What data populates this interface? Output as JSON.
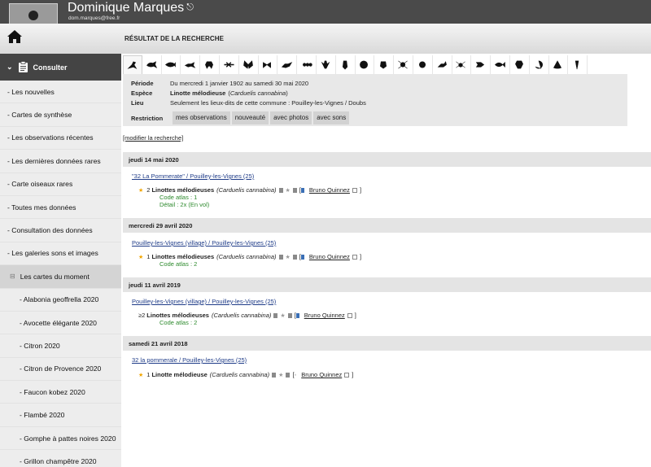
{
  "user": {
    "name": "Dominique Marques",
    "email": "dom.marques@free.fr"
  },
  "page": {
    "title": "RÉSULTAT DE LA RECHERCHE"
  },
  "sidebar": {
    "section": "Consulter",
    "items": [
      "- Les nouvelles",
      "- Cartes de synthèse",
      "- Les observations récentes",
      "- Les dernières données rares",
      "- Carte oiseaux rares",
      "- Toutes mes données",
      "- Consultation des données",
      "- Les galeries sons et images"
    ],
    "group": "Les cartes du moment",
    "subitems": [
      "- Alabonia geoffrella 2020",
      "- Avocette élégante 2020",
      "- Citron 2020",
      "- Citron de Provence 2020",
      "- Faucon kobez 2020",
      "- Flambé 2020",
      "- Gomphe à pattes noires 2020",
      "- Grillon champêtre 2020"
    ]
  },
  "criteria": {
    "period_label": "Période",
    "period_value": "Du mercredi 1 janvier 1902 au samedi 30 mai 2020",
    "species_label": "Espèce",
    "species_name": "Linotte mélodieuse",
    "species_latin": "Carduelis cannabina",
    "place_label": "Lieu",
    "place_value": "Seulement les lieux-dits de cette commune : Pouilley-les-Vignes / Doubs",
    "restriction_label": "Restriction",
    "tabs": [
      "mes observations",
      "nouveauté",
      "avec photos",
      "avec sons"
    ]
  },
  "modify_link": "[modifier la recherche]",
  "observations": [
    {
      "date": "jeudi 14 mai 2020",
      "location": "\"32 La Pommerate\" / Pouilley-les-Vignes (25)",
      "count": "2",
      "species": "Linottes mélodieuses",
      "latin": "(Carduelis cannabina)",
      "observer": "Bruno Quinnez",
      "code": "Code atlas : 1",
      "detail": "Détail : 2x (En vol)"
    },
    {
      "date": "mercredi 29 avril 2020",
      "location": "Pouilley-les-Vignes (village) / Pouilley-les-Vignes (25)",
      "count": "1",
      "species": "Linottes mélodieuses",
      "latin": "(Carduelis cannabina)",
      "observer": "Bruno Quinnez",
      "code": "Code atlas : 2"
    },
    {
      "date": "jeudi 11 avril 2019",
      "location": "Pouilley-les-Vignes (village) / Pouilley-les-Vignes (25)",
      "count": "≥2",
      "species": "Linottes mélodieuses",
      "latin": "(Carduelis cannabina)",
      "observer": "Bruno Quinnez",
      "code": "Code atlas : 2"
    },
    {
      "date": "samedi 21 avril 2018",
      "location": "32 la pommerale / Pouilley-les-Vignes (25)",
      "count": "1",
      "species": "Linotte mélodieuse",
      "latin": "(Carduelis cannabina)",
      "observer": "Bruno Quinnez"
    }
  ],
  "taxon_icons": [
    "bird-icon",
    "mammal-icon",
    "fish-whale-icon",
    "lizard-icon",
    "frog-icon",
    "dragonfly-icon",
    "butterfly-icon",
    "moth-icon",
    "grasshopper-icon",
    "ant-icon",
    "mantis-icon",
    "cicada-icon",
    "beetle-icon",
    "bug-icon",
    "spider-crab-icon",
    "ladybug-icon",
    "scorpion-icon",
    "spider-icon",
    "shrimp-icon",
    "fish-icon",
    "lobster-icon",
    "snail-icon",
    "shell-icon",
    "misc-icon"
  ],
  "colors": {
    "header": "#4a4a4a",
    "link": "#1f3c88",
    "atlas": "#2d8a2d",
    "star": "#f2a600"
  }
}
